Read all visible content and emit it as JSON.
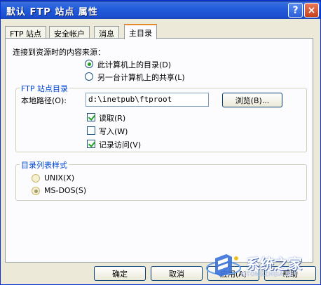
{
  "window": {
    "title": "默认 FTP 站点 属性",
    "help_glyph": "?",
    "close_glyph": "×"
  },
  "tabs": [
    {
      "label": "FTP 站点"
    },
    {
      "label": "安全帐户"
    },
    {
      "label": "消息"
    },
    {
      "label": "主目录"
    }
  ],
  "content_source": {
    "label": "连接到资源时的内容来源：",
    "options": [
      {
        "label": "此计算机上的目录(D)",
        "selected": true
      },
      {
        "label": "另一台计算机上的共享(L)",
        "selected": false
      }
    ]
  },
  "ftp_dir": {
    "title": "FTP 站点目录",
    "path_label": "本地路径(O):",
    "path_value": "d:\\inetpub\\ftproot",
    "browse_label": "浏览(B)...",
    "checks": [
      {
        "label": "读取(R)",
        "checked": true
      },
      {
        "label": "写入(W)",
        "checked": false
      },
      {
        "label": "记录访问(V)",
        "checked": true
      }
    ]
  },
  "list_style": {
    "title": "目录列表样式",
    "options": [
      {
        "label": "UNIX(X)",
        "selected": false
      },
      {
        "label": "MS-DOS(S)",
        "selected": true
      }
    ]
  },
  "buttons": {
    "ok": "确定",
    "cancel": "取消",
    "apply": "应用(A)",
    "help": "帮助"
  },
  "watermark": {
    "text": "系统之家",
    "url": "XITONGZHIJIA.NET"
  }
}
